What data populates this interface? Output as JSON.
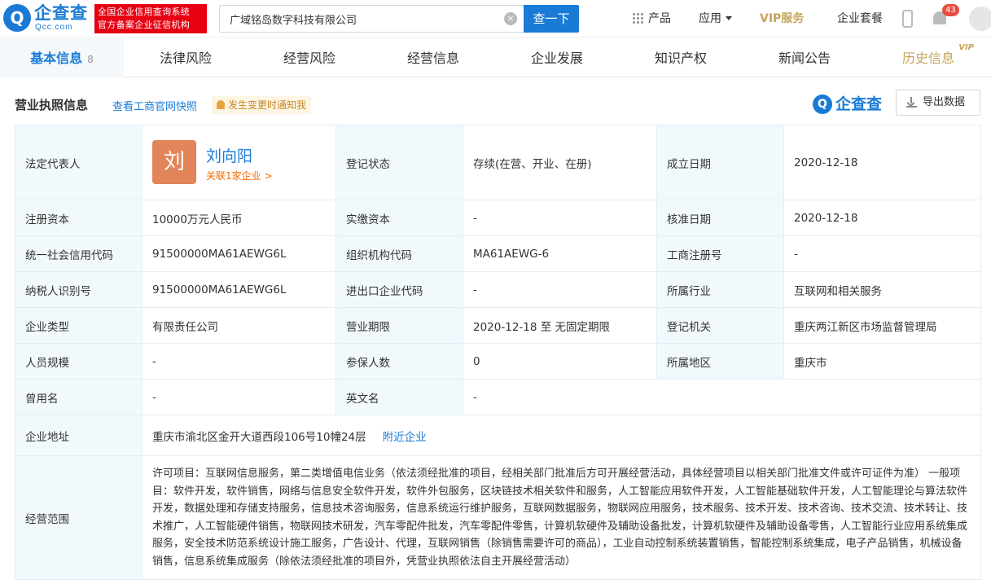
{
  "header": {
    "logo_text": "企查查",
    "logo_sub": "Qcc.com",
    "badge_line1": "全国企业信用查询系统",
    "badge_line2": "官方备案企业征信机构",
    "search_value": "广域铭岛数字科技有限公司",
    "search_button": "查一下",
    "nav_products": "产品",
    "nav_apps": "应用",
    "nav_vip": "VIP服务",
    "nav_package": "企业套餐",
    "notification_count": "43"
  },
  "tabs": [
    {
      "label": "基本信息",
      "count": "8"
    },
    {
      "label": "法律风险"
    },
    {
      "label": "经营风险"
    },
    {
      "label": "经营信息"
    },
    {
      "label": "企业发展"
    },
    {
      "label": "知识产权"
    },
    {
      "label": "新闻公告"
    },
    {
      "label": "历史信息",
      "badge": "VIP"
    }
  ],
  "section": {
    "title": "营业执照信息",
    "link": "查看工商官网快照",
    "notify": "发生变更时通知我",
    "brand": "企查查",
    "export": "导出数据"
  },
  "legal_rep": {
    "label": "法定代表人",
    "avatar_char": "刘",
    "name": "刘向阳",
    "related": "关联1家企业 >"
  },
  "fields": {
    "reg_status_label": "登记状态",
    "reg_status": "存续(在营、开业、在册)",
    "est_date_label": "成立日期",
    "est_date": "2020-12-18",
    "reg_capital_label": "注册资本",
    "reg_capital": "10000万元人民币",
    "paid_capital_label": "实缴资本",
    "paid_capital": "-",
    "approval_date_label": "核准日期",
    "approval_date": "2020-12-18",
    "credit_code_label": "统一社会信用代码",
    "credit_code": "91500000MA61AEWG6L",
    "org_code_label": "组织机构代码",
    "org_code": "MA61AEWG-6",
    "biz_reg_no_label": "工商注册号",
    "biz_reg_no": "-",
    "taxpayer_id_label": "纳税人识别号",
    "taxpayer_id": "91500000MA61AEWG6L",
    "import_export_label": "进出口企业代码",
    "import_export": "-",
    "industry_label": "所属行业",
    "industry": "互联网和相关服务",
    "company_type_label": "企业类型",
    "company_type": "有限责任公司",
    "term_label": "营业期限",
    "term": "2020-12-18 至 无固定期限",
    "authority_label": "登记机关",
    "authority": "重庆两江新区市场监督管理局",
    "staff_size_label": "人员规模",
    "staff_size": "-",
    "insured_label": "参保人数",
    "insured": "0",
    "region_label": "所属地区",
    "region": "重庆市",
    "former_name_label": "曾用名",
    "former_name": "-",
    "english_name_label": "英文名",
    "english_name": "-",
    "address_label": "企业地址",
    "address": "重庆市渝北区金开大道西段106号10幢24层",
    "nearby_link": "附近企业",
    "scope_label": "经营范围",
    "scope": "许可项目：互联网信息服务，第二类增值电信业务（依法须经批准的项目，经相关部门批准后方可开展经营活动，具体经营项目以相关部门批准文件或许可证件为准） 一般项目：软件开发，软件销售，网络与信息安全软件开发，软件外包服务，区块链技术相关软件和服务，人工智能应用软件开发，人工智能基础软件开发，人工智能理论与算法软件开发，数据处理和存储支持服务，信息技术咨询服务，信息系统运行维护服务，互联网数据服务，物联网应用服务，技术服务、技术开发、技术咨询、技术交流、技术转让、技术推广，人工智能硬件销售，物联网技术研发，汽车零配件批发，汽车零配件零售，计算机软硬件及辅助设备批发，计算机软硬件及辅助设备零售，人工智能行业应用系统集成服务，安全技术防范系统设计施工服务，广告设计、代理，互联网销售（除销售需要许可的商品），工业自动控制系统装置销售，智能控制系统集成，电子产品销售，机械设备销售，信息系统集成服务（除依法须经批准的项目外，凭营业执照依法自主开展经营活动）"
  },
  "colors": {
    "brand_blue": "#1a7bd6",
    "badge_red": "#e60012",
    "vip_gold": "#c7a45a",
    "label_bg": "#f2f9fc",
    "avatar_orange": "#e2855a"
  }
}
